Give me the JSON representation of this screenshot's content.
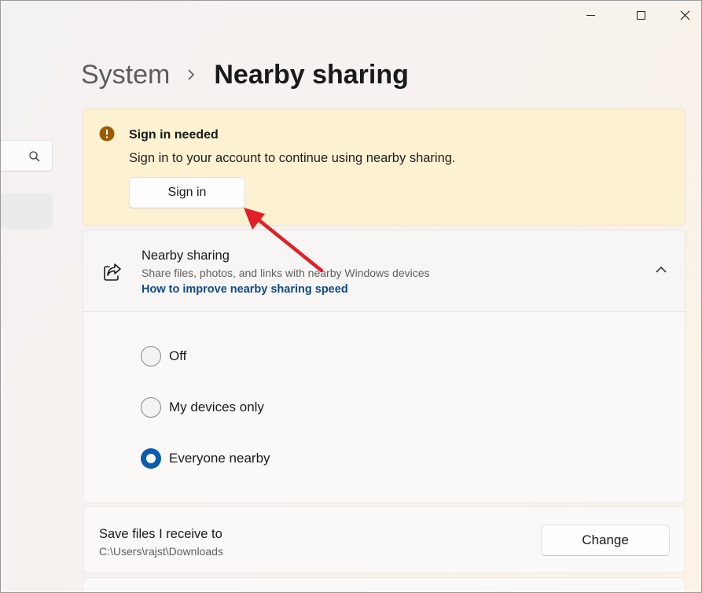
{
  "window_controls": {
    "minimize_icon": "minimize-icon",
    "maximize_icon": "maximize-icon",
    "close_icon": "close-icon"
  },
  "sidebar": {
    "search_icon": "search-icon"
  },
  "header": {
    "breadcrumb_parent": "System",
    "breadcrumb_separator_icon": "chevron-right-icon",
    "page_title": "Nearby sharing"
  },
  "banner": {
    "icon": "warning-icon",
    "title": "Sign in needed",
    "message": "Sign in to your account to continue using nearby sharing.",
    "button_label": "Sign in",
    "color": "#fcf1d1"
  },
  "nearby_sharing": {
    "icon": "share-icon",
    "title": "Nearby sharing",
    "description": "Share files, photos, and links with nearby Windows devices",
    "link": "How to improve nearby sharing speed",
    "expanded": true,
    "options": [
      {
        "label": "Off",
        "checked": false
      },
      {
        "label": "My devices only",
        "checked": false
      },
      {
        "label": "Everyone nearby",
        "checked": true
      }
    ],
    "accent_color": "#0b5cad"
  },
  "save_location": {
    "title": "Save files I receive to",
    "path": "C:\\Users\\rajst\\Downloads",
    "button_label": "Change"
  },
  "annotation": {
    "type": "arrow",
    "color": "#e41e26",
    "points_to": "sign-in-button"
  }
}
